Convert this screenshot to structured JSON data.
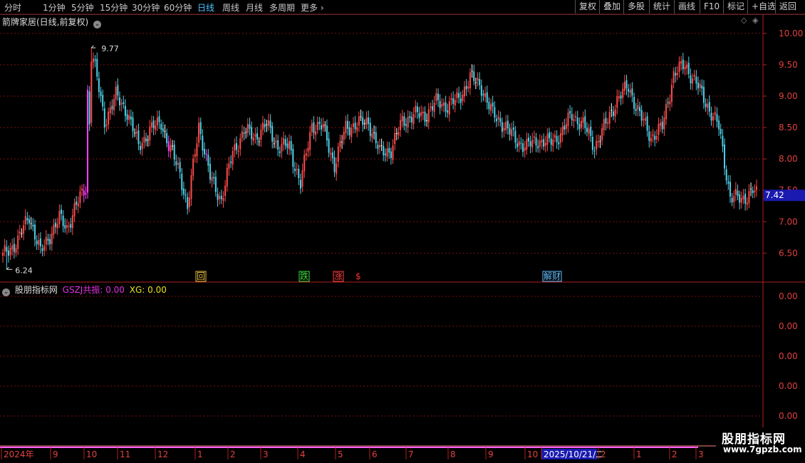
{
  "toolbar": {
    "timeframes": [
      "分时",
      "1分钟",
      "5分钟",
      "15分钟",
      "30分钟",
      "60分钟",
      "日线",
      "周线",
      "月线",
      "多周期",
      "更多"
    ],
    "active_timeframe": "日线",
    "buttons": [
      "复权",
      "叠加",
      "多股",
      "统计",
      "画线",
      "F10",
      "标记",
      "+自选",
      "返回"
    ]
  },
  "main_title": "箭牌家居(日线,前复权)",
  "indicator": {
    "name": "股朋指标网",
    "line1": "GSZJ共振: 0.00",
    "line2": "XG: 0.00",
    "colors": {
      "line1": "#e030e0",
      "line2": "#e8e020"
    }
  },
  "chart_data": {
    "type": "candlestick",
    "price_axis_ticks": [
      "10.00",
      "9.50",
      "9.00",
      "8.50",
      "8.00",
      "7.50",
      "7.00",
      "6.50"
    ],
    "ylim": [
      6.05,
      10.1
    ],
    "high_label": "9.77",
    "low_label": "6.24",
    "current_price": "7.42",
    "indicator_axis_ticks": [
      "0.00",
      "0.00",
      "0.00",
      "0.00",
      "0.00"
    ],
    "event_markers": [
      {
        "text": "回",
        "color": "#e8c040"
      },
      {
        "text": "跌",
        "color": "#40e040"
      },
      {
        "text": "涨",
        "color": "#ff4040"
      },
      {
        "text": "$",
        "color": "#ff3030"
      },
      {
        "text": "解财",
        "color": "#60c0ff"
      }
    ],
    "time_axis": [
      "2024年",
      "9",
      "10",
      "11",
      "12",
      "1",
      "2",
      "3",
      "4",
      "5",
      "6",
      "7",
      "8",
      "9",
      "10",
      "2025/10/21/二",
      "2",
      "1",
      "2",
      "3"
    ],
    "colors": {
      "up": "#ff4a4a",
      "down": "#4fd0e8",
      "limit": "#ff40ff",
      "flat": "#ffffff"
    }
  },
  "watermark": {
    "line1": "股朋指标网",
    "line2": "www.7gpzb.com"
  }
}
